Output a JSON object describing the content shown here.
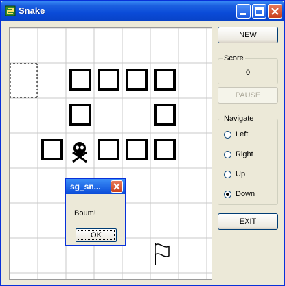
{
  "window": {
    "title": "Snake",
    "icon": "snake-app-icon"
  },
  "controls": {
    "new_label": "NEW",
    "score_label": "Score",
    "score_value": "0",
    "pause_label": "PAUSE",
    "navigate_label": "Navigate",
    "directions": [
      {
        "label": "Left",
        "selected": false
      },
      {
        "label": "Right",
        "selected": false
      },
      {
        "label": "Up",
        "selected": false
      },
      {
        "label": "Down",
        "selected": true
      }
    ],
    "exit_label": "EXIT"
  },
  "dialog": {
    "title": "sg_sn...",
    "message": "Boum!",
    "ok_label": "OK"
  },
  "board": {
    "columns": 7,
    "rows": 7,
    "snake_cells": [
      [
        2,
        1
      ],
      [
        3,
        1
      ],
      [
        4,
        1
      ],
      [
        5,
        1
      ],
      [
        2,
        2
      ],
      [
        5,
        2
      ],
      [
        1,
        3
      ],
      [
        3,
        3
      ],
      [
        4,
        3
      ],
      [
        5,
        3
      ]
    ],
    "skull_cell": [
      2,
      3
    ],
    "flag_cell": [
      5,
      6
    ],
    "cursor_cell": [
      0,
      1
    ],
    "icons": {
      "skull": "skull-crossbones-icon",
      "flag": "flag-icon"
    }
  }
}
